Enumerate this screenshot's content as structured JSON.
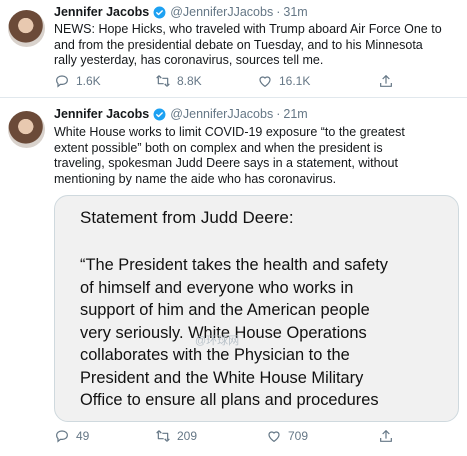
{
  "tweets": [
    {
      "name": "Jennifer Jacobs",
      "handle": "@JenniferJJacobs",
      "separator": "·",
      "time": "31m",
      "lines": [
        "NEWS: Hope Hicks, who traveled with Trump aboard Air Force One to",
        "and from the presidential debate on Tuesday, and to his Minnesota",
        "rally yesterday, has coronavirus, sources tell me."
      ],
      "counts": {
        "reply": "1.6K",
        "retweet": "8.8K",
        "like": "16.1K"
      }
    },
    {
      "name": "Jennifer Jacobs",
      "handle": "@JenniferJJacobs",
      "separator": "·",
      "time": "21m",
      "lines": [
        "White House works to limit COVID-19 exposure  “to the greatest",
        "extent possible”  both on complex and when the president is",
        "traveling, spokesman Judd Deere says in a statement, without",
        "mentioning by name the aide who has coronavirus."
      ],
      "card": {
        "title": "Statement from Judd Deere:",
        "lines": [
          "“The President takes the health and safety",
          "of himself and everyone who works in",
          "support of him and the American people",
          "very seriously. White House Operations",
          "collaborates with the Physician to the",
          "President and the White House Military",
          "Office to ensure all plans and procedures"
        ]
      },
      "counts": {
        "reply": "49",
        "retweet": "209",
        "like": "709"
      }
    }
  ],
  "watermark": "@环球网",
  "colors": {
    "verified": "#1da1f2",
    "meta": "#657786",
    "divider": "#e1e8ed"
  },
  "icons": [
    "verified-badge-icon",
    "reply-icon",
    "retweet-icon",
    "like-icon",
    "share-icon"
  ]
}
